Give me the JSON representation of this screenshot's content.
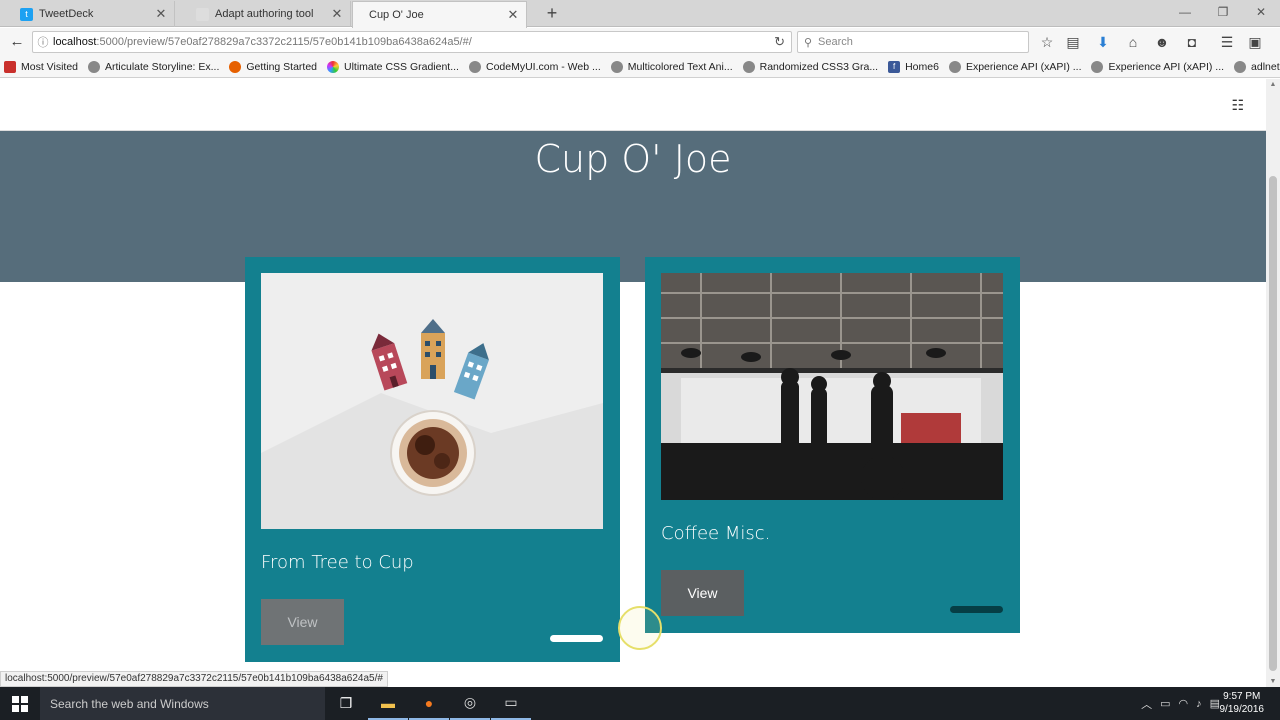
{
  "browser": {
    "tabs": [
      {
        "label": "TweetDeck"
      },
      {
        "label": "Adapt authoring tool"
      },
      {
        "label": "Cup O' Joe"
      }
    ],
    "url_host": "localhost",
    "url_path": ":5000/preview/57e0af278829a7c3372c2115/57e0b141b109ba6438a624a5/#/",
    "search_placeholder": "Search",
    "bookmarks": [
      {
        "label": "Most Visited"
      },
      {
        "label": "Articulate Storyline: Ex..."
      },
      {
        "label": "Getting Started"
      },
      {
        "label": "Ultimate CSS Gradient..."
      },
      {
        "label": "CodeMyUI.com - Web ..."
      },
      {
        "label": "Multicolored Text Ani..."
      },
      {
        "label": "Randomized CSS3 Gra..."
      },
      {
        "label": "Home6"
      },
      {
        "label": "Experience API (xAPI) ..."
      },
      {
        "label": "Experience API (xAPI) ..."
      },
      {
        "label": "adlnet.github.io"
      }
    ],
    "status_link": "localhost:5000/preview/57e0af278829a7c3372c2115/57e0b141b109ba6438a624a5/#"
  },
  "page": {
    "hero_title": "Cup O' Joe",
    "cards": [
      {
        "title": "From Tree to Cup",
        "button": "View",
        "progress": 1.0
      },
      {
        "title": "Coffee Misc.",
        "button": "View",
        "progress": 0.0
      }
    ]
  },
  "colors": {
    "hero": "#566d7b",
    "card": "#13808f",
    "button": "#5b5f61"
  },
  "taskbar": {
    "search_placeholder": "Search the web and Windows",
    "time": "9:57 PM",
    "date": "9/19/2016"
  }
}
